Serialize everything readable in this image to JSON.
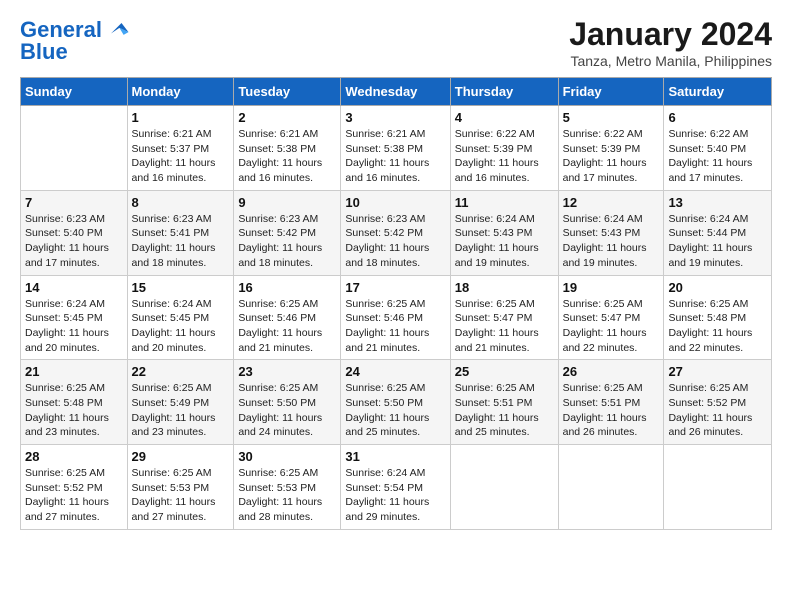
{
  "logo": {
    "line1": "General",
    "line2": "Blue"
  },
  "title": "January 2024",
  "subtitle": "Tanza, Metro Manila, Philippines",
  "days_of_week": [
    "Sunday",
    "Monday",
    "Tuesday",
    "Wednesday",
    "Thursday",
    "Friday",
    "Saturday"
  ],
  "weeks": [
    [
      {
        "num": "",
        "info": ""
      },
      {
        "num": "1",
        "info": "Sunrise: 6:21 AM\nSunset: 5:37 PM\nDaylight: 11 hours\nand 16 minutes."
      },
      {
        "num": "2",
        "info": "Sunrise: 6:21 AM\nSunset: 5:38 PM\nDaylight: 11 hours\nand 16 minutes."
      },
      {
        "num": "3",
        "info": "Sunrise: 6:21 AM\nSunset: 5:38 PM\nDaylight: 11 hours\nand 16 minutes."
      },
      {
        "num": "4",
        "info": "Sunrise: 6:22 AM\nSunset: 5:39 PM\nDaylight: 11 hours\nand 16 minutes."
      },
      {
        "num": "5",
        "info": "Sunrise: 6:22 AM\nSunset: 5:39 PM\nDaylight: 11 hours\nand 17 minutes."
      },
      {
        "num": "6",
        "info": "Sunrise: 6:22 AM\nSunset: 5:40 PM\nDaylight: 11 hours\nand 17 minutes."
      }
    ],
    [
      {
        "num": "7",
        "info": "Sunrise: 6:23 AM\nSunset: 5:40 PM\nDaylight: 11 hours\nand 17 minutes."
      },
      {
        "num": "8",
        "info": "Sunrise: 6:23 AM\nSunset: 5:41 PM\nDaylight: 11 hours\nand 18 minutes."
      },
      {
        "num": "9",
        "info": "Sunrise: 6:23 AM\nSunset: 5:42 PM\nDaylight: 11 hours\nand 18 minutes."
      },
      {
        "num": "10",
        "info": "Sunrise: 6:23 AM\nSunset: 5:42 PM\nDaylight: 11 hours\nand 18 minutes."
      },
      {
        "num": "11",
        "info": "Sunrise: 6:24 AM\nSunset: 5:43 PM\nDaylight: 11 hours\nand 19 minutes."
      },
      {
        "num": "12",
        "info": "Sunrise: 6:24 AM\nSunset: 5:43 PM\nDaylight: 11 hours\nand 19 minutes."
      },
      {
        "num": "13",
        "info": "Sunrise: 6:24 AM\nSunset: 5:44 PM\nDaylight: 11 hours\nand 19 minutes."
      }
    ],
    [
      {
        "num": "14",
        "info": "Sunrise: 6:24 AM\nSunset: 5:45 PM\nDaylight: 11 hours\nand 20 minutes."
      },
      {
        "num": "15",
        "info": "Sunrise: 6:24 AM\nSunset: 5:45 PM\nDaylight: 11 hours\nand 20 minutes."
      },
      {
        "num": "16",
        "info": "Sunrise: 6:25 AM\nSunset: 5:46 PM\nDaylight: 11 hours\nand 21 minutes."
      },
      {
        "num": "17",
        "info": "Sunrise: 6:25 AM\nSunset: 5:46 PM\nDaylight: 11 hours\nand 21 minutes."
      },
      {
        "num": "18",
        "info": "Sunrise: 6:25 AM\nSunset: 5:47 PM\nDaylight: 11 hours\nand 21 minutes."
      },
      {
        "num": "19",
        "info": "Sunrise: 6:25 AM\nSunset: 5:47 PM\nDaylight: 11 hours\nand 22 minutes."
      },
      {
        "num": "20",
        "info": "Sunrise: 6:25 AM\nSunset: 5:48 PM\nDaylight: 11 hours\nand 22 minutes."
      }
    ],
    [
      {
        "num": "21",
        "info": "Sunrise: 6:25 AM\nSunset: 5:48 PM\nDaylight: 11 hours\nand 23 minutes."
      },
      {
        "num": "22",
        "info": "Sunrise: 6:25 AM\nSunset: 5:49 PM\nDaylight: 11 hours\nand 23 minutes."
      },
      {
        "num": "23",
        "info": "Sunrise: 6:25 AM\nSunset: 5:50 PM\nDaylight: 11 hours\nand 24 minutes."
      },
      {
        "num": "24",
        "info": "Sunrise: 6:25 AM\nSunset: 5:50 PM\nDaylight: 11 hours\nand 25 minutes."
      },
      {
        "num": "25",
        "info": "Sunrise: 6:25 AM\nSunset: 5:51 PM\nDaylight: 11 hours\nand 25 minutes."
      },
      {
        "num": "26",
        "info": "Sunrise: 6:25 AM\nSunset: 5:51 PM\nDaylight: 11 hours\nand 26 minutes."
      },
      {
        "num": "27",
        "info": "Sunrise: 6:25 AM\nSunset: 5:52 PM\nDaylight: 11 hours\nand 26 minutes."
      }
    ],
    [
      {
        "num": "28",
        "info": "Sunrise: 6:25 AM\nSunset: 5:52 PM\nDaylight: 11 hours\nand 27 minutes."
      },
      {
        "num": "29",
        "info": "Sunrise: 6:25 AM\nSunset: 5:53 PM\nDaylight: 11 hours\nand 27 minutes."
      },
      {
        "num": "30",
        "info": "Sunrise: 6:25 AM\nSunset: 5:53 PM\nDaylight: 11 hours\nand 28 minutes."
      },
      {
        "num": "31",
        "info": "Sunrise: 6:24 AM\nSunset: 5:54 PM\nDaylight: 11 hours\nand 29 minutes."
      },
      {
        "num": "",
        "info": ""
      },
      {
        "num": "",
        "info": ""
      },
      {
        "num": "",
        "info": ""
      }
    ]
  ]
}
